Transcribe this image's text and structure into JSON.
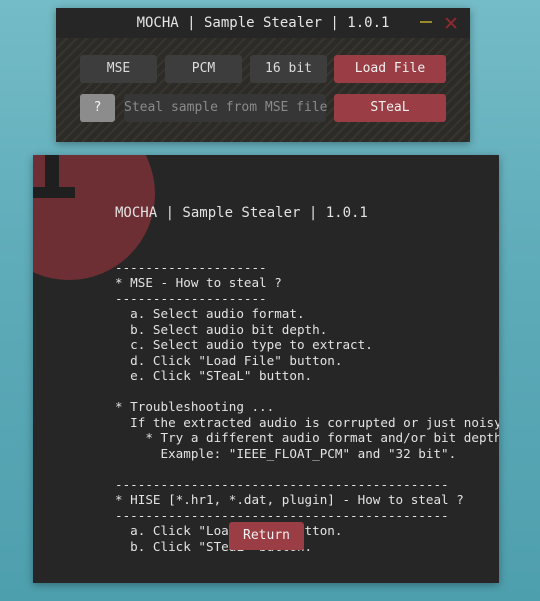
{
  "window": {
    "title": "MOCHA | Sample Stealer | 1.0.1",
    "minimize_icon": "minimize-icon",
    "close_icon": "close-icon"
  },
  "controls": {
    "format_label": "MSE",
    "audio_format_label": "PCM",
    "bit_depth_label": "16 bit",
    "load_file_label": "Load File",
    "help_label": "?",
    "hint_text": "Steal sample from MSE file",
    "steal_label": "STeaL"
  },
  "help": {
    "icon": "info-icon",
    "title": "MOCHA | Sample Stealer | 1.0.1",
    "lines": [
      "--------------------",
      "* MSE - How to steal ?",
      "--------------------",
      "  a. Select audio format.",
      "  b. Select audio bit depth.",
      "  c. Select audio type to extract.",
      "  d. Click \"Load File\" button.",
      "  e. Click \"STeaL\" button.",
      "",
      "* Troubleshooting ...",
      "  If the extracted audio is corrupted or just noisy:",
      "    * Try a different audio format and/or bit depth;",
      "      Example: \"IEEE_FLOAT_PCM\" and \"32 bit\".",
      "",
      "--------------------------------------------",
      "* HISE [*.hr1, *.dat, plugin] - How to steal ?",
      "--------------------------------------------",
      "  a. Click \"Load File\" button.",
      "  b. Click \"STeaL\" button."
    ],
    "return_label": "Return"
  },
  "colors": {
    "accent": "#9a3d44",
    "panel": "#262626",
    "button": "#3d3d3d",
    "info_circle": "#6e2f34",
    "desktop": "#5eabb9"
  }
}
